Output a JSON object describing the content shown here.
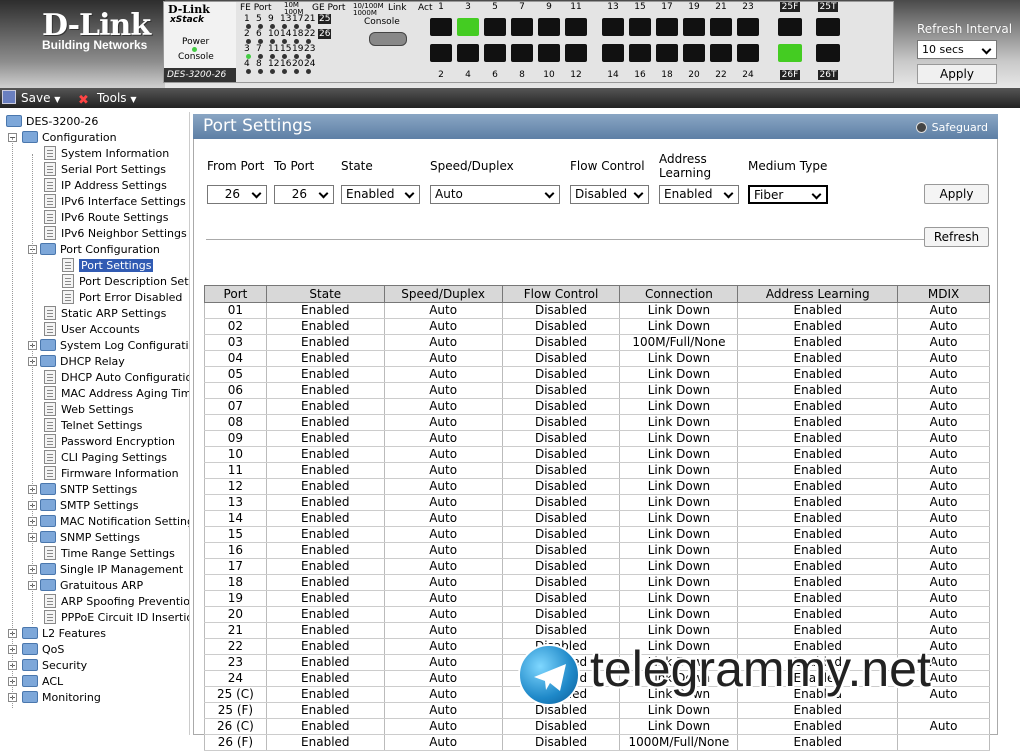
{
  "header": {
    "logo": "D-Link",
    "logo_sub": "Building Networks",
    "device": {
      "brand": "D-Link",
      "xstack": "xStack",
      "power": "Power",
      "console": "Console",
      "model": "DES-3200-26",
      "console_port": "Console",
      "fe_label": "FE Port",
      "ge_label": "GE Port",
      "speed_a": "10M",
      "speed_b": "100M",
      "speed_c": "10/100M",
      "speed_d": "1000M",
      "link": "Link",
      "act": "Act"
    },
    "refresh": {
      "label": "Refresh Interval",
      "value": "10 secs",
      "apply": "Apply"
    }
  },
  "toolbar": {
    "save": "Save",
    "tools": "Tools"
  },
  "sidebar": {
    "root": "DES-3200-26",
    "config": "Configuration",
    "items": [
      "System Information",
      "Serial Port Settings",
      "IP Address Settings",
      "IPv6 Interface Settings",
      "IPv6 Route Settings",
      "IPv6 Neighbor Settings"
    ],
    "port_config": "Port Configuration",
    "port_sub": [
      "Port Settings",
      "Port Description Settings",
      "Port Error Disabled"
    ],
    "items2": [
      "Static ARP Settings",
      "User Accounts",
      "System Log Configuration",
      "DHCP Relay",
      "DHCP Auto Configuration",
      "MAC Address Aging Time",
      "Web Settings",
      "Telnet Settings",
      "Password Encryption",
      "CLI Paging Settings",
      "Firmware Information",
      "SNTP Settings",
      "SMTP Settings",
      "MAC Notification Settings",
      "SNMP Settings",
      "Time Range Settings",
      "Single IP Management",
      "Gratuitous ARP",
      "ARP Spoofing Prevention",
      "PPPoE Circuit ID Insertion"
    ],
    "top": [
      "L2 Features",
      "QoS",
      "Security",
      "ACL",
      "Monitoring"
    ]
  },
  "main": {
    "title": "Port Settings",
    "safeguard": "Safeguard",
    "form": {
      "from_port": "From Port",
      "to_port": "To Port",
      "state": "State",
      "speed": "Speed/Duplex",
      "flow": "Flow Control",
      "addr": "Address Learning",
      "medium": "Medium Type",
      "from_val": "26",
      "to_val": "26",
      "state_val": "Enabled",
      "speed_val": "Auto",
      "flow_val": "Disabled",
      "addr_val": "Enabled",
      "medium_val": "Fiber",
      "apply": "Apply",
      "refresh": "Refresh"
    },
    "columns": [
      "Port",
      "State",
      "Speed/Duplex",
      "Flow Control",
      "Connection",
      "Address Learning",
      "MDIX"
    ],
    "rows": [
      [
        "01",
        "Enabled",
        "Auto",
        "Disabled",
        "Link Down",
        "Enabled",
        "Auto"
      ],
      [
        "02",
        "Enabled",
        "Auto",
        "Disabled",
        "Link Down",
        "Enabled",
        "Auto"
      ],
      [
        "03",
        "Enabled",
        "Auto",
        "Disabled",
        "100M/Full/None",
        "Enabled",
        "Auto"
      ],
      [
        "04",
        "Enabled",
        "Auto",
        "Disabled",
        "Link Down",
        "Enabled",
        "Auto"
      ],
      [
        "05",
        "Enabled",
        "Auto",
        "Disabled",
        "Link Down",
        "Enabled",
        "Auto"
      ],
      [
        "06",
        "Enabled",
        "Auto",
        "Disabled",
        "Link Down",
        "Enabled",
        "Auto"
      ],
      [
        "07",
        "Enabled",
        "Auto",
        "Disabled",
        "Link Down",
        "Enabled",
        "Auto"
      ],
      [
        "08",
        "Enabled",
        "Auto",
        "Disabled",
        "Link Down",
        "Enabled",
        "Auto"
      ],
      [
        "09",
        "Enabled",
        "Auto",
        "Disabled",
        "Link Down",
        "Enabled",
        "Auto"
      ],
      [
        "10",
        "Enabled",
        "Auto",
        "Disabled",
        "Link Down",
        "Enabled",
        "Auto"
      ],
      [
        "11",
        "Enabled",
        "Auto",
        "Disabled",
        "Link Down",
        "Enabled",
        "Auto"
      ],
      [
        "12",
        "Enabled",
        "Auto",
        "Disabled",
        "Link Down",
        "Enabled",
        "Auto"
      ],
      [
        "13",
        "Enabled",
        "Auto",
        "Disabled",
        "Link Down",
        "Enabled",
        "Auto"
      ],
      [
        "14",
        "Enabled",
        "Auto",
        "Disabled",
        "Link Down",
        "Enabled",
        "Auto"
      ],
      [
        "15",
        "Enabled",
        "Auto",
        "Disabled",
        "Link Down",
        "Enabled",
        "Auto"
      ],
      [
        "16",
        "Enabled",
        "Auto",
        "Disabled",
        "Link Down",
        "Enabled",
        "Auto"
      ],
      [
        "17",
        "Enabled",
        "Auto",
        "Disabled",
        "Link Down",
        "Enabled",
        "Auto"
      ],
      [
        "18",
        "Enabled",
        "Auto",
        "Disabled",
        "Link Down",
        "Enabled",
        "Auto"
      ],
      [
        "19",
        "Enabled",
        "Auto",
        "Disabled",
        "Link Down",
        "Enabled",
        "Auto"
      ],
      [
        "20",
        "Enabled",
        "Auto",
        "Disabled",
        "Link Down",
        "Enabled",
        "Auto"
      ],
      [
        "21",
        "Enabled",
        "Auto",
        "Disabled",
        "Link Down",
        "Enabled",
        "Auto"
      ],
      [
        "22",
        "Enabled",
        "Auto",
        "Disabled",
        "Link Down",
        "Enabled",
        "Auto"
      ],
      [
        "23",
        "Enabled",
        "Auto",
        "Disabled",
        "Link Down",
        "Enabled",
        "Auto"
      ],
      [
        "24",
        "Enabled",
        "Auto",
        "Disabled",
        "Link Down",
        "Enabled",
        "Auto"
      ],
      [
        "25 (C)",
        "Enabled",
        "Auto",
        "Disabled",
        "Link Down",
        "Enabled",
        "Auto"
      ],
      [
        "25 (F)",
        "Enabled",
        "Auto",
        "Disabled",
        "Link Down",
        "Enabled",
        ""
      ],
      [
        "26 (C)",
        "Enabled",
        "Auto",
        "Disabled",
        "Link Down",
        "Enabled",
        "Auto"
      ],
      [
        "26 (F)",
        "Enabled",
        "Auto",
        "Disabled",
        "1000M/Full/None",
        "Enabled",
        ""
      ]
    ]
  },
  "watermark": "telegrammy.net",
  "colors": {
    "header_blue": "#5d7fa5",
    "port_lit": "#44cc22",
    "selected": "#315bb3"
  }
}
